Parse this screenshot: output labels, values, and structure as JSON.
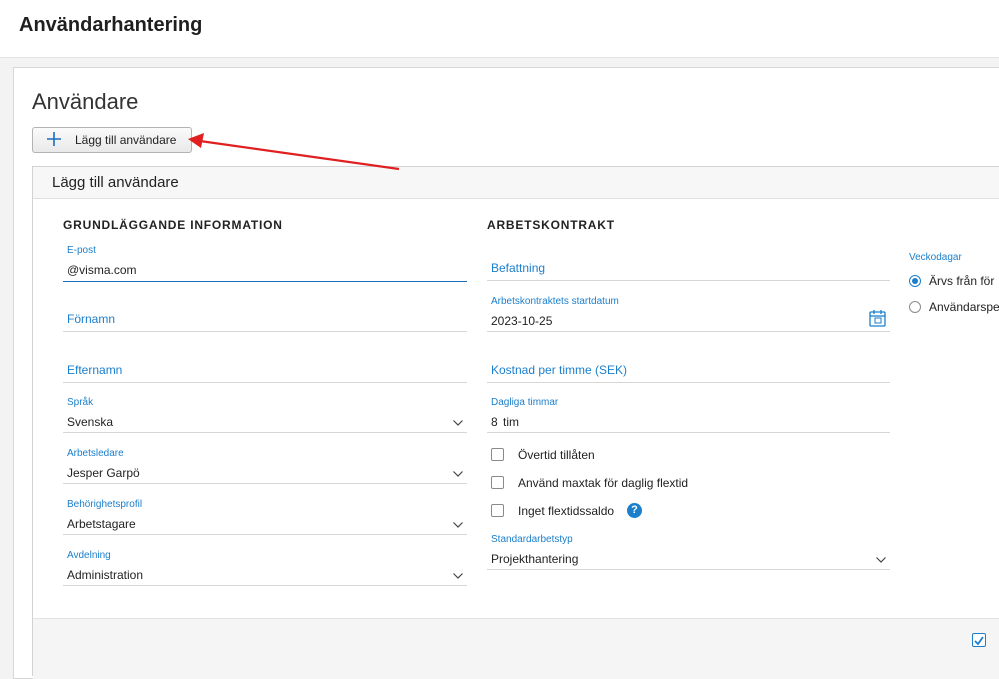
{
  "app": {
    "title": "Användarhantering"
  },
  "page": {
    "title": "Användare",
    "add_button_label": "Lägg till användare"
  },
  "panel": {
    "title": "Lägg till användare",
    "basic": {
      "heading": "GRUNDLÄGGANDE INFORMATION",
      "email": {
        "label": "E-post",
        "value": "@visma.com"
      },
      "first_name": {
        "placeholder": "Förnamn"
      },
      "last_name": {
        "placeholder": "Efternamn"
      },
      "language": {
        "label": "Språk",
        "value": "Svenska"
      },
      "supervisor": {
        "label": "Arbetsledare",
        "value": "Jesper Garpö"
      },
      "permission_profile": {
        "label": "Behörighetsprofil",
        "value": "Arbetstagare"
      },
      "department": {
        "label": "Avdelning",
        "value": "Administration"
      }
    },
    "contract": {
      "heading": "ARBETSKONTRAKT",
      "position": {
        "placeholder": "Befattning"
      },
      "start_date": {
        "label": "Arbetskontraktets startdatum",
        "value": "2023-10-25"
      },
      "hourly_cost": {
        "placeholder": "Kostnad per timme (SEK)"
      },
      "daily_hours": {
        "label": "Dagliga timmar",
        "value": "8",
        "unit": "tim"
      },
      "checkboxes": [
        {
          "label": "Övertid tillåten",
          "checked": false
        },
        {
          "label": "Använd maxtak för daglig flextid",
          "checked": false
        },
        {
          "label": "Inget flextidssaldo",
          "checked": false
        }
      ],
      "help_icon": "?",
      "default_work_type": {
        "label": "Standardarbetstyp",
        "value": "Projekthantering"
      }
    },
    "weekdays": {
      "label": "Veckodagar",
      "options": [
        {
          "label": "Ärvs från för",
          "selected": true
        },
        {
          "label": "Användarspe",
          "selected": false
        }
      ]
    },
    "footer": {
      "checkbox_checked": true
    }
  },
  "colors": {
    "accent": "#1b7fcc",
    "annotation_arrow": "#e02020"
  }
}
